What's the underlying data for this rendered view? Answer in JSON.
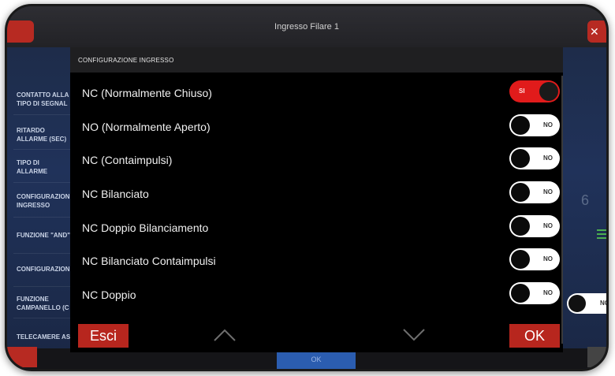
{
  "header": {
    "title": "Ingresso Filare 1"
  },
  "background_list": [
    {
      "label": "CONTATTO ALLA\nTIPO DI SEGNAL"
    },
    {
      "label": "RITARDO\nALLARME (SEC)"
    },
    {
      "label": "TIPO DI\nALLARME"
    },
    {
      "label": "CONFIGURAZION\nINGRESSO"
    },
    {
      "label": "FUNZIONE \"AND\""
    },
    {
      "label": "CONFIGURAZION"
    },
    {
      "label": "FUNZIONE\nCAMPANELLO (C"
    },
    {
      "label": "TELECAMERE AS"
    }
  ],
  "background_value": "6",
  "background_toggle": {
    "text": "NO"
  },
  "background_ok": "OK",
  "dialog": {
    "title": "CONFIGURAZIONE INGRESSO",
    "options": [
      {
        "label": "NC (Normalmente Chiuso)",
        "state_text": "SI",
        "on": true
      },
      {
        "label": "NO (Normalmente Aperto)",
        "state_text": "NO",
        "on": false
      },
      {
        "label": "NC (Contaimpulsi)",
        "state_text": "NO",
        "on": false
      },
      {
        "label": "NC Bilanciato",
        "state_text": "NO",
        "on": false
      },
      {
        "label": "NC Doppio Bilanciamento",
        "state_text": "NO",
        "on": false
      },
      {
        "label": "NC Bilanciato Contaimpulsi",
        "state_text": "NO",
        "on": false
      },
      {
        "label": "NC Doppio",
        "state_text": "NO",
        "on": false
      }
    ],
    "cancel_label": "Esci",
    "ok_label": "OK"
  },
  "icons": {
    "up": "chevron-up-icon",
    "down": "chevron-down-icon",
    "menu": "hamburger-menu-icon"
  },
  "colors": {
    "accent_red": "#e11b1b",
    "button_red": "#b7261e",
    "ok_blue": "#2b5db0",
    "menu_green": "#4caf50"
  }
}
